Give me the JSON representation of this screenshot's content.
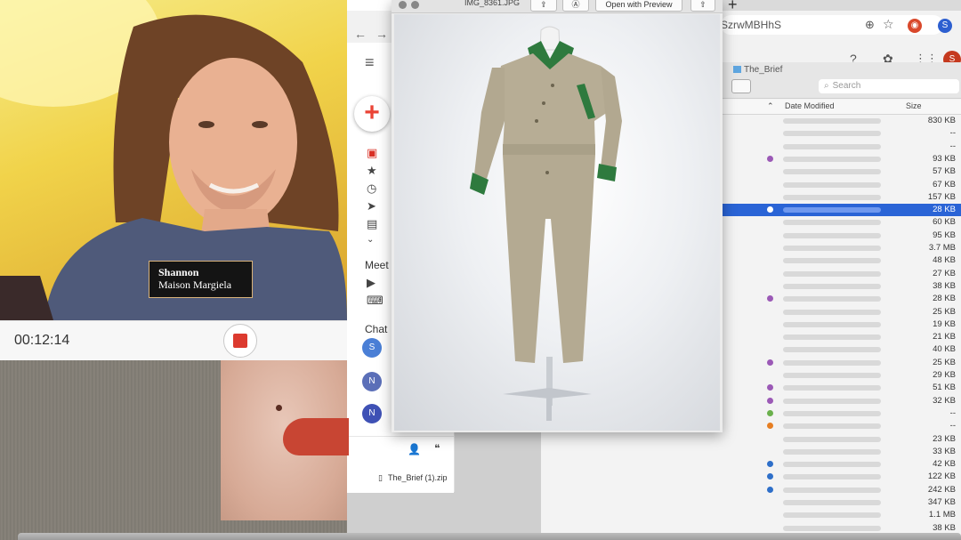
{
  "browser": {
    "address_suffix": "SzrwMBHhS",
    "new_tab": "+",
    "profile_initial": "S"
  },
  "finder": {
    "title": "The_Brief",
    "search_placeholder": "Search",
    "columns": {
      "date_modified": "Date Modified",
      "size": "Size"
    },
    "rows": [
      {
        "size": "830 KB",
        "dot": ""
      },
      {
        "size": "--",
        "dot": ""
      },
      {
        "size": "--",
        "dot": ""
      },
      {
        "size": "93 KB",
        "dot": "#9b59b6"
      },
      {
        "size": "57 KB",
        "dot": ""
      },
      {
        "size": "67 KB",
        "dot": ""
      },
      {
        "size": "157 KB",
        "dot": ""
      },
      {
        "size": "28 KB",
        "dot": "#ffffff",
        "selected": true
      },
      {
        "size": "60 KB",
        "dot": ""
      },
      {
        "size": "95 KB",
        "dot": ""
      },
      {
        "size": "3.7 MB",
        "dot": ""
      },
      {
        "size": "48 KB",
        "dot": ""
      },
      {
        "size": "27 KB",
        "dot": ""
      },
      {
        "size": "38 KB",
        "dot": ""
      },
      {
        "size": "28 KB",
        "dot": "#9b59b6"
      },
      {
        "size": "25 KB",
        "dot": ""
      },
      {
        "size": "19 KB",
        "dot": ""
      },
      {
        "size": "21 KB",
        "dot": ""
      },
      {
        "size": "40 KB",
        "dot": ""
      },
      {
        "size": "25 KB",
        "dot": "#9b59b6"
      },
      {
        "size": "29 KB",
        "dot": ""
      },
      {
        "size": "51 KB",
        "dot": "#9b59b6"
      },
      {
        "size": "32 KB",
        "dot": "#9b59b6"
      },
      {
        "size": "--",
        "dot": "#6ab04c"
      },
      {
        "size": "--",
        "dot": "#e67e22"
      },
      {
        "size": "23 KB",
        "dot": ""
      },
      {
        "size": "33 KB",
        "dot": ""
      },
      {
        "size": "42 KB",
        "dot": "#2e6fc9"
      },
      {
        "size": "122 KB",
        "dot": "#2e6fc9"
      },
      {
        "size": "242 KB",
        "dot": "#2e6fc9"
      },
      {
        "size": "347 KB",
        "dot": ""
      },
      {
        "size": "1.1 MB",
        "dot": ""
      },
      {
        "size": "38 KB",
        "dot": ""
      }
    ]
  },
  "gmail": {
    "sections": {
      "meet": "Meet",
      "chat": "Chat"
    },
    "chat_avatars": [
      {
        "initial": "S",
        "color": "#4a7fd6"
      },
      {
        "initial": "N",
        "color": "#5b6fb8"
      },
      {
        "initial": "N",
        "color": "#3f51b5"
      }
    ],
    "download_file": "The_Brief (1).zip"
  },
  "preview": {
    "filename": "IMG_8361.JPG",
    "open_with": "Open with Preview"
  },
  "video": {
    "name": "Shannon",
    "company": "Maison Margiela",
    "elapsed": "00:12:14"
  }
}
